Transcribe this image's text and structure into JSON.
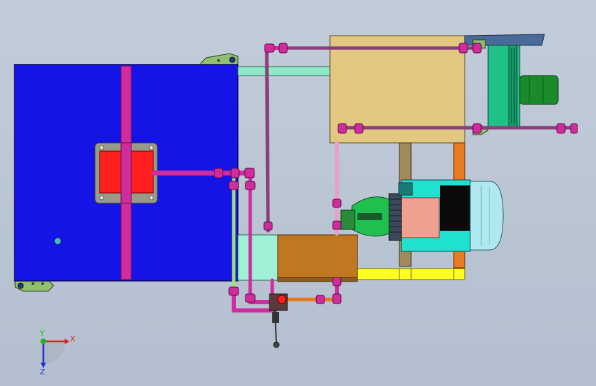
{
  "scene": {
    "background": "#b9c4d3",
    "description_colors": {
      "tank": "#1414e6",
      "tank_edge": "#0a0a5a",
      "pipe_magenta": "#d12c9e",
      "pipe_dark": "#8a3f7a",
      "mint_duct": "#8fe8c8",
      "cooler_box": "#e2c880",
      "motor_teal": "#20e0d0",
      "motor_housing": "#b0e8f0",
      "pump_green": "#20c050",
      "valve_block": "#c07820",
      "yellow_frame": "#ffff20",
      "orange_post": "#e87a20",
      "red_panel": "#ff2020",
      "fan_green": "#20c088",
      "fan_motor": "#1a8a2a",
      "salmon_box": "#f0a090"
    }
  },
  "axis_triad": {
    "x_label": "X",
    "y_label": "Y",
    "z_label": "Z",
    "x_color": "#e02020",
    "y_color": "#20b020",
    "z_color": "#2030d0"
  }
}
